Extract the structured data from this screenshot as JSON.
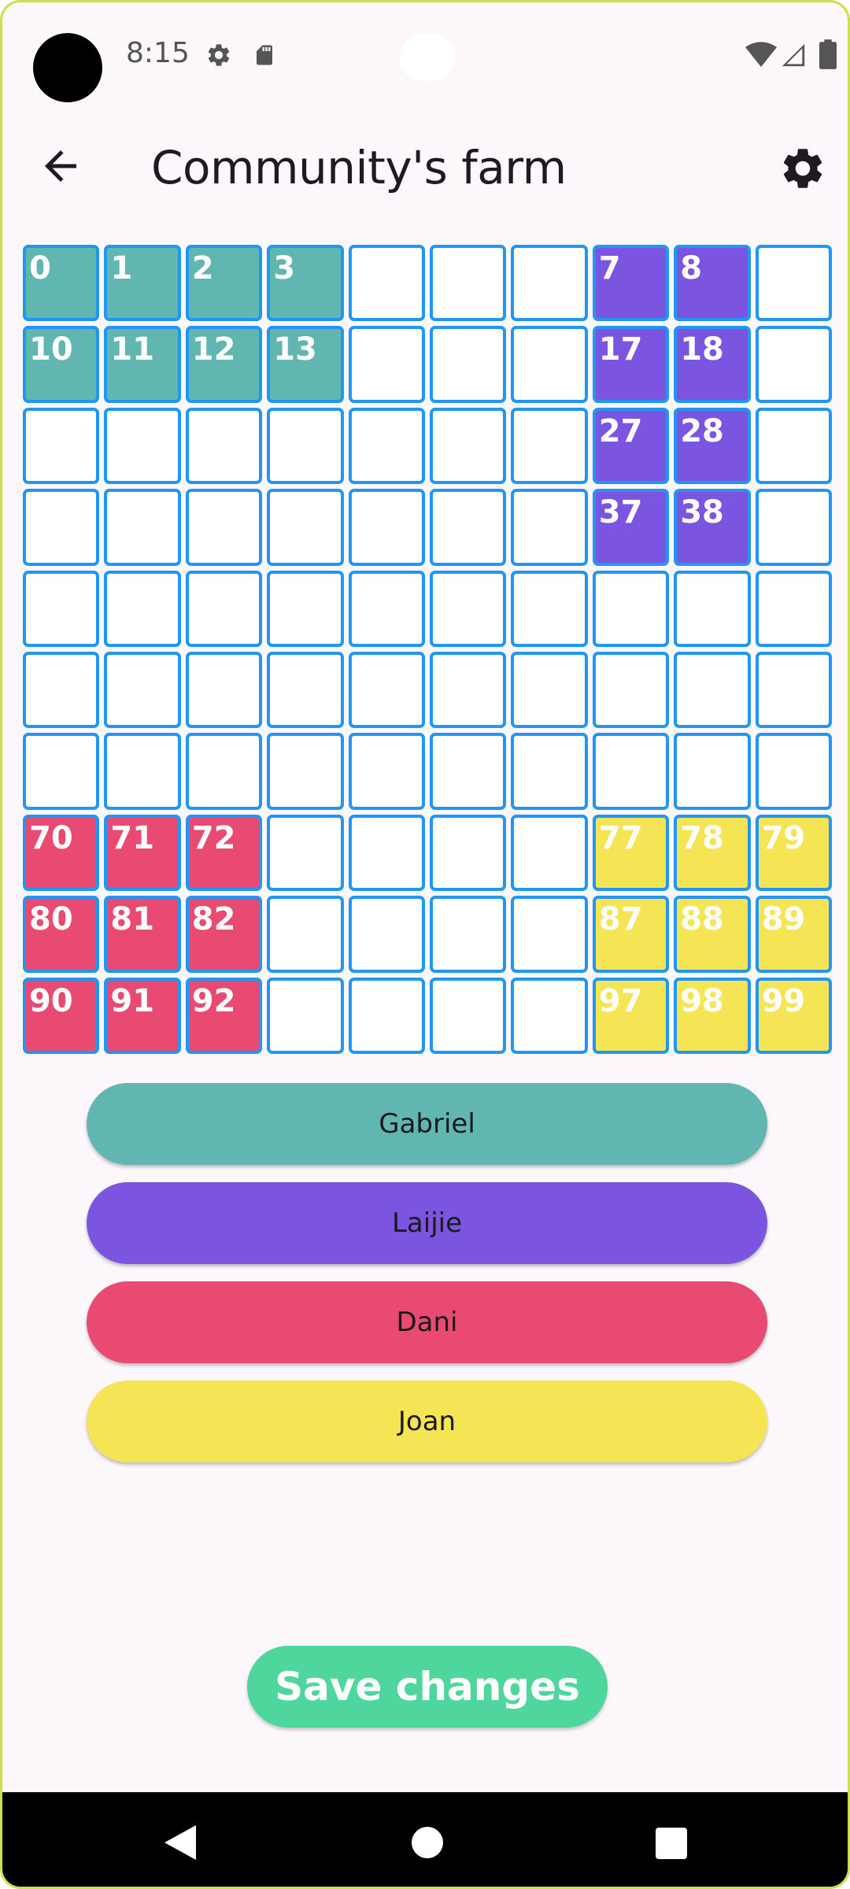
{
  "status_bar": {
    "time": "8:15",
    "icons": [
      "settings-icon",
      "sd-card-icon",
      "wifi-icon",
      "signal-icon",
      "battery-icon"
    ]
  },
  "app_bar": {
    "title": "Community's farm",
    "back_icon": "arrow-back-icon",
    "settings_icon": "gear-icon"
  },
  "colors": {
    "grid_border": "#2196f3",
    "empty_cell": "#ffffff",
    "Gabriel": "#62b6b2",
    "Laijie": "#7b55df",
    "Dani": "#e84a72",
    "Joan": "#f5e454",
    "save_button": "#4fd69c"
  },
  "grid": {
    "rows": 10,
    "cols": 10,
    "assigned_cells": [
      {
        "id": 0,
        "owner": "Gabriel"
      },
      {
        "id": 1,
        "owner": "Gabriel"
      },
      {
        "id": 2,
        "owner": "Gabriel"
      },
      {
        "id": 3,
        "owner": "Gabriel"
      },
      {
        "id": 10,
        "owner": "Gabriel"
      },
      {
        "id": 11,
        "owner": "Gabriel"
      },
      {
        "id": 12,
        "owner": "Gabriel"
      },
      {
        "id": 13,
        "owner": "Gabriel"
      },
      {
        "id": 7,
        "owner": "Laijie"
      },
      {
        "id": 8,
        "owner": "Laijie"
      },
      {
        "id": 17,
        "owner": "Laijie"
      },
      {
        "id": 18,
        "owner": "Laijie"
      },
      {
        "id": 27,
        "owner": "Laijie"
      },
      {
        "id": 28,
        "owner": "Laijie"
      },
      {
        "id": 37,
        "owner": "Laijie"
      },
      {
        "id": 38,
        "owner": "Laijie"
      },
      {
        "id": 70,
        "owner": "Dani"
      },
      {
        "id": 71,
        "owner": "Dani"
      },
      {
        "id": 72,
        "owner": "Dani"
      },
      {
        "id": 80,
        "owner": "Dani"
      },
      {
        "id": 81,
        "owner": "Dani"
      },
      {
        "id": 82,
        "owner": "Dani"
      },
      {
        "id": 90,
        "owner": "Dani"
      },
      {
        "id": 91,
        "owner": "Dani"
      },
      {
        "id": 92,
        "owner": "Dani"
      },
      {
        "id": 77,
        "owner": "Joan"
      },
      {
        "id": 78,
        "owner": "Joan"
      },
      {
        "id": 79,
        "owner": "Joan"
      },
      {
        "id": 87,
        "owner": "Joan"
      },
      {
        "id": 88,
        "owner": "Joan"
      },
      {
        "id": 89,
        "owner": "Joan"
      },
      {
        "id": 97,
        "owner": "Joan"
      },
      {
        "id": 98,
        "owner": "Joan"
      },
      {
        "id": 99,
        "owner": "Joan"
      }
    ]
  },
  "owners": [
    {
      "name": "Gabriel"
    },
    {
      "name": "Laijie"
    },
    {
      "name": "Dani"
    },
    {
      "name": "Joan"
    }
  ],
  "save_button": {
    "label": "Save changes"
  },
  "nav_bar": {
    "icons": [
      "nav-back-icon",
      "nav-home-icon",
      "nav-recents-icon"
    ]
  }
}
